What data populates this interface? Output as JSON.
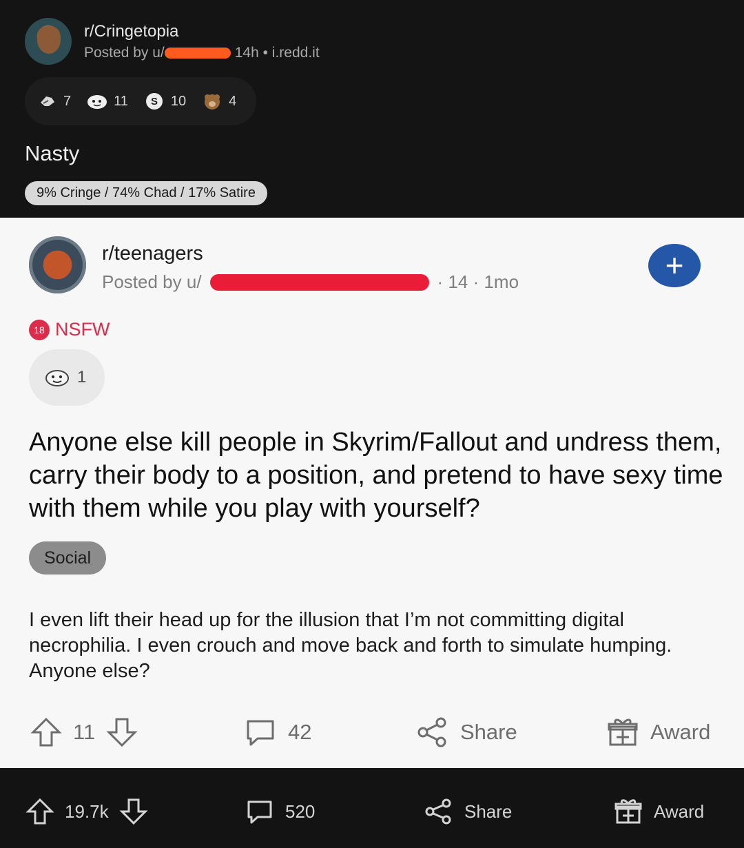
{
  "top_post": {
    "subreddit": "r/Cringetopia",
    "posted_prefix": "Posted by u/",
    "meta": "14h • i.redd.it",
    "awards": [
      {
        "icon": "salute-icon",
        "count": "7"
      },
      {
        "icon": "wholesome-icon",
        "count": "11"
      },
      {
        "icon": "silver-coin-icon",
        "count": "10"
      },
      {
        "icon": "bear-icon",
        "count": "4"
      }
    ],
    "title": "Nasty",
    "flair": "9% Cringe / 74% Chad / 17% Satire"
  },
  "embedded_post": {
    "subreddit": "r/teenagers",
    "posted_prefix": "Posted by u/",
    "meta_suffix": "· 14 · 1mo",
    "nsfw_badge": "18",
    "nsfw_label": "NSFW",
    "award_count": "1",
    "title": "Anyone else kill people in Skyrim/Fallout and undress them, carry their body to a position, and pretend to have sexy time with them while you play with yourself?",
    "flair": "Social",
    "body": "I even lift their head up for the illusion that I’m not committing digital necrophilia. I even crouch and move back and forth to simulate humping. Anyone else?",
    "actions": {
      "upvotes": "11",
      "comments": "42",
      "share": "Share",
      "award": "Award"
    }
  },
  "main_actions": {
    "upvotes": "19.7k",
    "comments": "520",
    "share": "Share",
    "award": "Award"
  },
  "colors": {
    "dark_bg": "#141414",
    "card_bg": "#f7f7f7",
    "accent_blue": "#2557a9",
    "nsfw_red": "#da2c4b",
    "redaction_orange": "#ff5a1f",
    "redaction_red": "#ea1d39"
  }
}
